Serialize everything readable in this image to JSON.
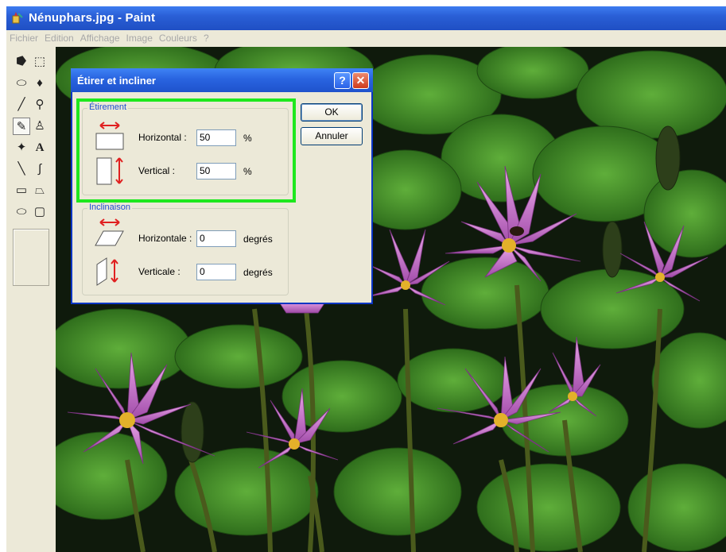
{
  "window": {
    "title": "Nénuphars.jpg - Paint"
  },
  "menu": {
    "items": [
      "Fichier",
      "Edition",
      "Affichage",
      "Image",
      "Couleurs",
      "?"
    ]
  },
  "tools": [
    {
      "name": "free-select-icon",
      "glyph": "⭓"
    },
    {
      "name": "rect-select-icon",
      "glyph": "⬚"
    },
    {
      "name": "eraser-icon",
      "glyph": "⬭"
    },
    {
      "name": "fill-bucket-icon",
      "glyph": "♦"
    },
    {
      "name": "color-picker-icon",
      "glyph": "╱"
    },
    {
      "name": "magnifier-icon",
      "glyph": "⚲"
    },
    {
      "name": "pencil-icon",
      "glyph": "✎"
    },
    {
      "name": "brush-icon",
      "glyph": "♙"
    },
    {
      "name": "airbrush-icon",
      "glyph": "✦"
    },
    {
      "name": "text-icon",
      "glyph": "A"
    },
    {
      "name": "line-icon",
      "glyph": "╲"
    },
    {
      "name": "curve-icon",
      "glyph": "∫"
    },
    {
      "name": "rectangle-icon",
      "glyph": "▭"
    },
    {
      "name": "polygon-icon",
      "glyph": "⏢"
    },
    {
      "name": "ellipse-icon",
      "glyph": "⬭"
    },
    {
      "name": "rounded-rect-icon",
      "glyph": "▢"
    }
  ],
  "dialog": {
    "title": "Étirer et incliner",
    "help": "?",
    "close": "✕",
    "ok": "OK",
    "cancel": "Annuler",
    "stretch": {
      "legend": "Étirement",
      "horizontal_label": "Horizontal :",
      "horizontal_value": "50",
      "vertical_label": "Vertical :",
      "vertical_value": "50",
      "unit": "%"
    },
    "skew": {
      "legend": "Inclinaison",
      "horizontal_label": "Horizontale :",
      "horizontal_value": "0",
      "vertical_label": "Verticale :",
      "vertical_value": "0",
      "unit": "degrés"
    }
  },
  "colors": {
    "title_blue": "#2a5fd6",
    "highlight_green": "#1ee81e",
    "legend_blue": "#1f4fd0",
    "arrow_red": "#e02020"
  }
}
